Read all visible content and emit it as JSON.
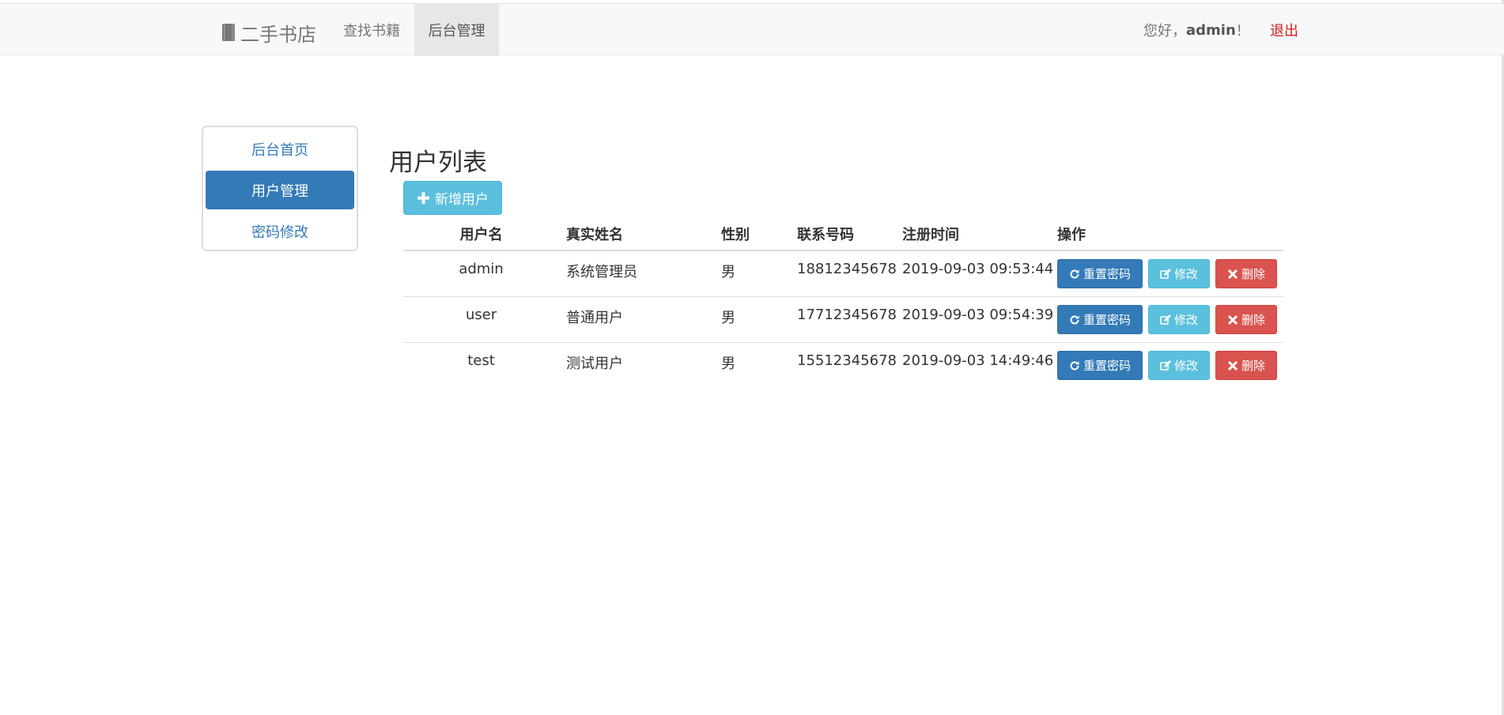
{
  "navbar": {
    "brand": "二手书店",
    "brand_icon": "book-icon",
    "links": [
      {
        "label": "查找书籍",
        "active": false
      },
      {
        "label": "后台管理",
        "active": true
      }
    ],
    "greeting_prefix": "您好，",
    "username": "admin",
    "greeting_suffix": "！",
    "logout": "退出"
  },
  "sidebar": {
    "items": [
      {
        "label": "后台首页",
        "active": false
      },
      {
        "label": "用户管理",
        "active": true
      },
      {
        "label": "密码修改",
        "active": false
      }
    ]
  },
  "main": {
    "title": "用户列表",
    "add_button": "新增用户",
    "columns": [
      "用户名",
      "真实姓名",
      "性别",
      "联系号码",
      "注册时间",
      "操作"
    ],
    "rows": [
      {
        "username": "admin",
        "realname": "系统管理员",
        "sex": "男",
        "phone": "18812345678",
        "registered": "2019-09-03 09:53:44"
      },
      {
        "username": "user",
        "realname": "普通用户",
        "sex": "男",
        "phone": "17712345678",
        "registered": "2019-09-03 09:54:39"
      },
      {
        "username": "test",
        "realname": "测试用户",
        "sex": "男",
        "phone": "15512345678",
        "registered": "2019-09-03 14:49:46"
      }
    ],
    "row_actions": {
      "reset": "重置密码",
      "edit": "修改",
      "delete": "删除"
    }
  },
  "colors": {
    "primary": "#337ab7",
    "info": "#5bc0de",
    "danger": "#d9534f",
    "logout": "#d9201f"
  }
}
